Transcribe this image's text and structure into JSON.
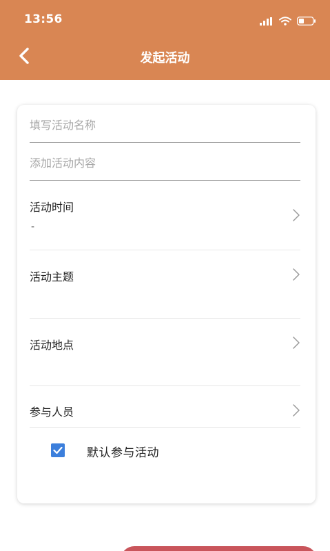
{
  "status_bar": {
    "time": "13:56"
  },
  "nav": {
    "title": "发起活动"
  },
  "form": {
    "name_placeholder": "填写活动名称",
    "content_placeholder": "添加活动内容",
    "time_label": "活动时间",
    "time_value": "-",
    "theme_label": "活动主题",
    "location_label": "活动地点",
    "participants_label": "参与人员",
    "default_participate_label": "默认参与活动",
    "default_participate_checked": true
  },
  "colors": {
    "header": "#d98653",
    "checkbox": "#3c7fdc",
    "submit": "#c9555b"
  },
  "icons": {
    "back": "chevron-left-icon",
    "row_arrow": "chevron-right-icon",
    "signal": "signal-icon",
    "wifi": "wifi-icon",
    "battery": "battery-icon",
    "check": "checkmark-icon"
  }
}
